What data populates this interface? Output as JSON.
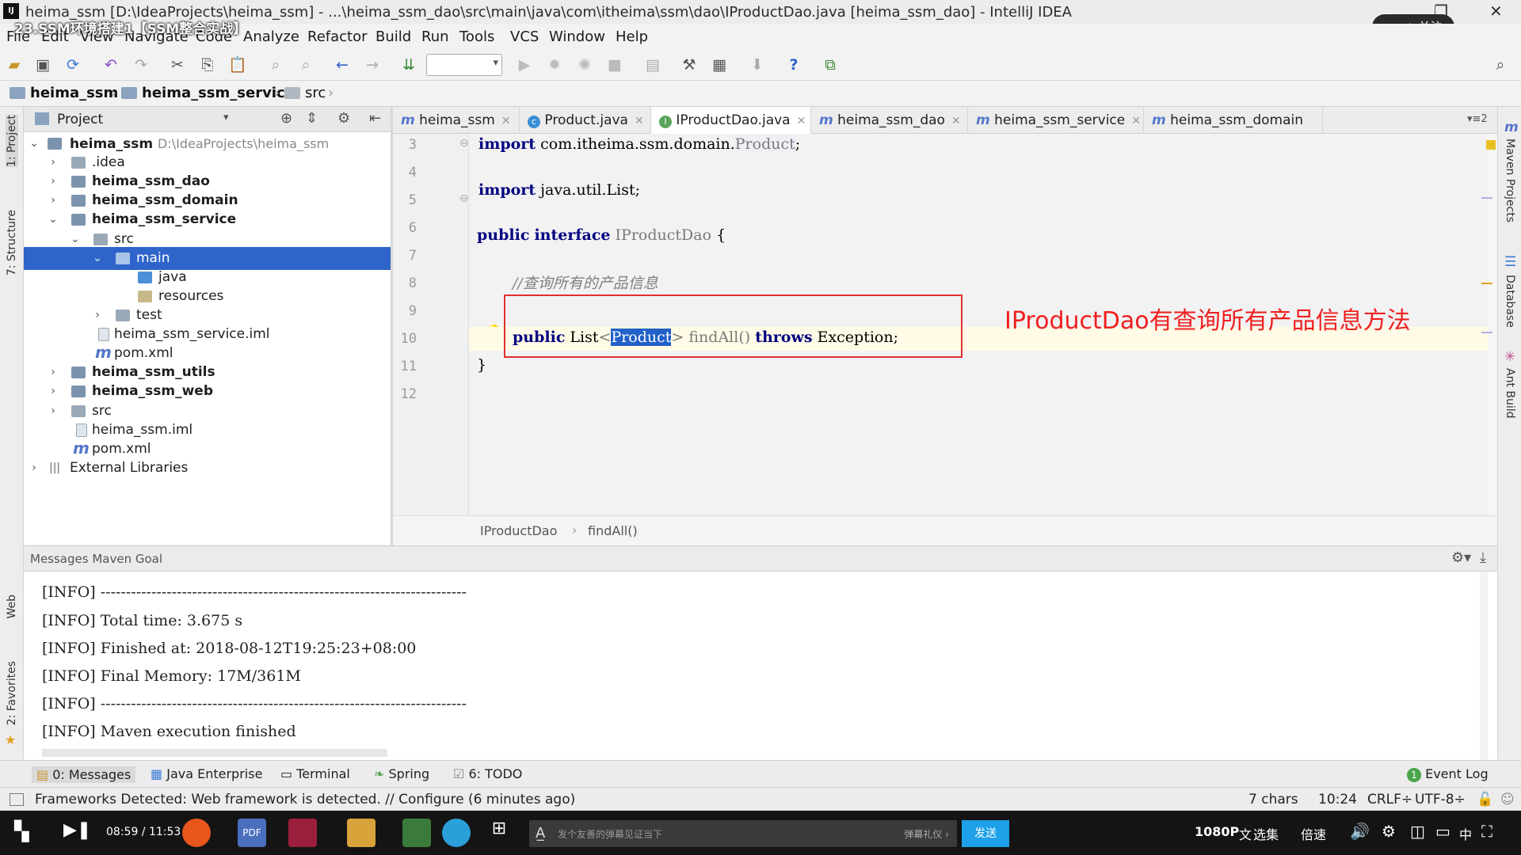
{
  "window": {
    "title": "heima_ssm [D:\\IdeaProjects\\heima_ssm] - ...\\heima_ssm_dao\\src\\main\\java\\com\\itheima\\ssm\\dao\\IProductDao.java [heima_ssm_dao] - IntelliJ IDEA"
  },
  "video_overlay": {
    "title": "23.SSM环境搭建1【SSM整合实战】",
    "follow": "+ 关注"
  },
  "menu": [
    "File",
    "Edit",
    "View",
    "Navigate",
    "Code",
    "Analyze",
    "Refactor",
    "Build",
    "Run",
    "Tools",
    "VCS",
    "Window",
    "Help"
  ],
  "navbar": {
    "crumbs": [
      "heima_ssm",
      "heima_ssm_service",
      "src"
    ]
  },
  "left_stripe": [
    "1: Project",
    "7: Structure",
    "Web",
    "2: Favorites"
  ],
  "right_stripe": [
    "Maven Projects",
    "Database",
    "Ant Build"
  ],
  "project": {
    "header": "Project",
    "tree": [
      {
        "label": "heima_ssm",
        "extra": "D:\\IdeaProjects\\heima_ssm"
      },
      {
        "label": ".idea"
      },
      {
        "label": "heima_ssm_dao"
      },
      {
        "label": "heima_ssm_domain"
      },
      {
        "label": "heima_ssm_service"
      },
      {
        "label": "src"
      },
      {
        "label": "main"
      },
      {
        "label": "java"
      },
      {
        "label": "resources"
      },
      {
        "label": "test"
      },
      {
        "label": "heima_ssm_service.iml"
      },
      {
        "label": "pom.xml"
      },
      {
        "label": "heima_ssm_utils"
      },
      {
        "label": "heima_ssm_web"
      },
      {
        "label": "src"
      },
      {
        "label": "heima_ssm.iml"
      },
      {
        "label": "pom.xml"
      },
      {
        "label": "External Libraries"
      }
    ]
  },
  "editor": {
    "tabs": [
      "heima_ssm",
      "Product.java",
      "IProductDao.java",
      "heima_ssm_dao",
      "heima_ssm_service",
      "heima_ssm_domain"
    ],
    "tab_count": "2",
    "line_numbers": [
      "3",
      "4",
      "5",
      "6",
      "7",
      "8",
      "9",
      "10",
      "11",
      "12"
    ],
    "code": {
      "l3_kw": "import",
      "l3_pkg": " com.itheima.ssm.domain.",
      "l3_cls": "Product",
      "l3_end": ";",
      "l5_kw": "import",
      "l5_rest": " java.util.List;",
      "l7_kw1": "public",
      "l7_kw2": "interface",
      "l7_name": "IProductDao",
      "l7_end": " {",
      "l9_comment": "//查询所有的产品信息",
      "l10_kw": "public",
      "l10_a": " List",
      "l10_lt": "<",
      "l10_type": "Product",
      "l10_gt": ">",
      "l10_m": " findAll() ",
      "l10_throws": "throws",
      "l10_end": " Exception;",
      "l11": "}"
    },
    "breadcrumb": [
      "IProductDao",
      "findAll()"
    ]
  },
  "annotation": "IProductDao有查询所有产品信息方法",
  "messages": {
    "header": "Messages Maven Goal",
    "lines": [
      "[INFO] ------------------------------------------------------------------------",
      "[INFO] Total time: 3.675 s",
      "[INFO] Finished at: 2018-08-12T19:25:23+08:00",
      "[INFO] Final Memory: 17M/361M",
      "[INFO] ------------------------------------------------------------------------",
      "[INFO] Maven execution finished"
    ]
  },
  "tool_tabs": [
    "0: Messages",
    "Java Enterprise",
    "Terminal",
    "Spring",
    "6: TODO"
  ],
  "event_log": "Event Log",
  "status": {
    "message": "Frameworks Detected: Web framework is detected. // Configure (6 minutes ago)",
    "chars": "7 chars",
    "position": "10:24",
    "line_sep": "CRLF÷",
    "encoding": "UTF-8÷"
  },
  "player": {
    "time": "08:59 / 11:53",
    "danmu_placeholder": "发个友善的弹幕见证当下",
    "danmu_etiquette": "弹幕礼仪 ›",
    "send": "发送",
    "quality": "1080P",
    "episodes": "选集",
    "speed": "倍速",
    "lang": "文",
    "ime": "中"
  }
}
